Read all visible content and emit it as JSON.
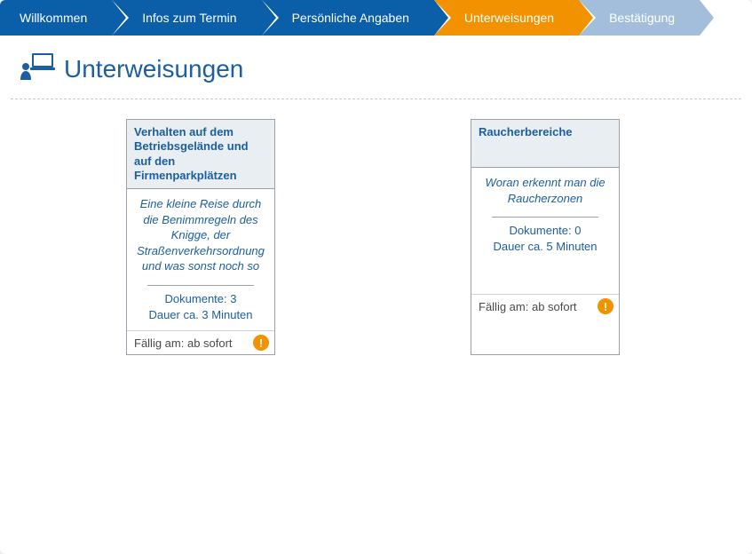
{
  "colors": {
    "primary": "#0b5ea8",
    "active": "#f39200",
    "disabled": "#a3bedb"
  },
  "crumbs": [
    {
      "label": "Willkommen",
      "state": "normal"
    },
    {
      "label": "Infos zum Termin",
      "state": "normal"
    },
    {
      "label": "Persönliche Angaben",
      "state": "normal"
    },
    {
      "label": "Unterweisungen",
      "state": "active"
    },
    {
      "label": "Bestätigung",
      "state": "disabled"
    }
  ],
  "page": {
    "title": "Unterweisungen",
    "icon": "training-icon"
  },
  "cards": [
    {
      "title": "Verhalten auf dem Betriebsgelände und auf den Firmenparkplätzen",
      "description": "Eine kleine Reise durch die Benimmregeln des Knigge, der Straßenverkehrsordnung und was sonst noch so",
      "docs_label": "Dokumente: 3",
      "duration_label": "Dauer ca. 3 Minuten",
      "due_label": "Fällig am: ab sofort",
      "alert": true
    },
    {
      "title": "Raucherbereiche",
      "description": "Woran erkennt man die Raucherzonen",
      "docs_label": "Dokumente: 0",
      "duration_label": "Dauer ca. 5 Minuten",
      "due_label": "Fällig am: ab sofort",
      "alert": true
    }
  ]
}
